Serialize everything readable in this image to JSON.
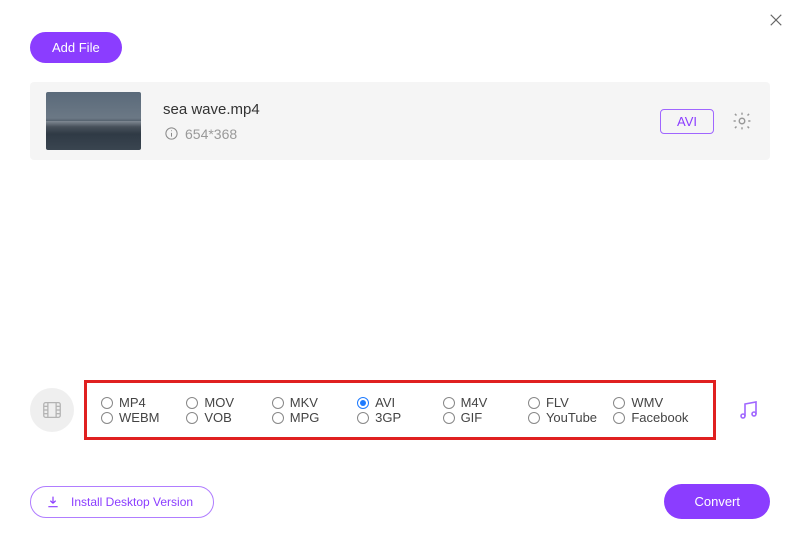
{
  "close_label": "Close",
  "add_file_label": "Add File",
  "file": {
    "name": "sea wave.mp4",
    "resolution": "654*368",
    "target_format": "AVI"
  },
  "formats": {
    "selected": "AVI",
    "row1": [
      "MP4",
      "MOV",
      "MKV",
      "AVI",
      "M4V",
      "FLV",
      "WMV"
    ],
    "row2": [
      "WEBM",
      "VOB",
      "MPG",
      "3GP",
      "GIF",
      "YouTube",
      "Facebook"
    ]
  },
  "install_label": "Install Desktop Version",
  "convert_label": "Convert",
  "colors": {
    "accent": "#8b3dff",
    "highlight_border": "#e02020",
    "radio_selected": "#1e7bff"
  }
}
